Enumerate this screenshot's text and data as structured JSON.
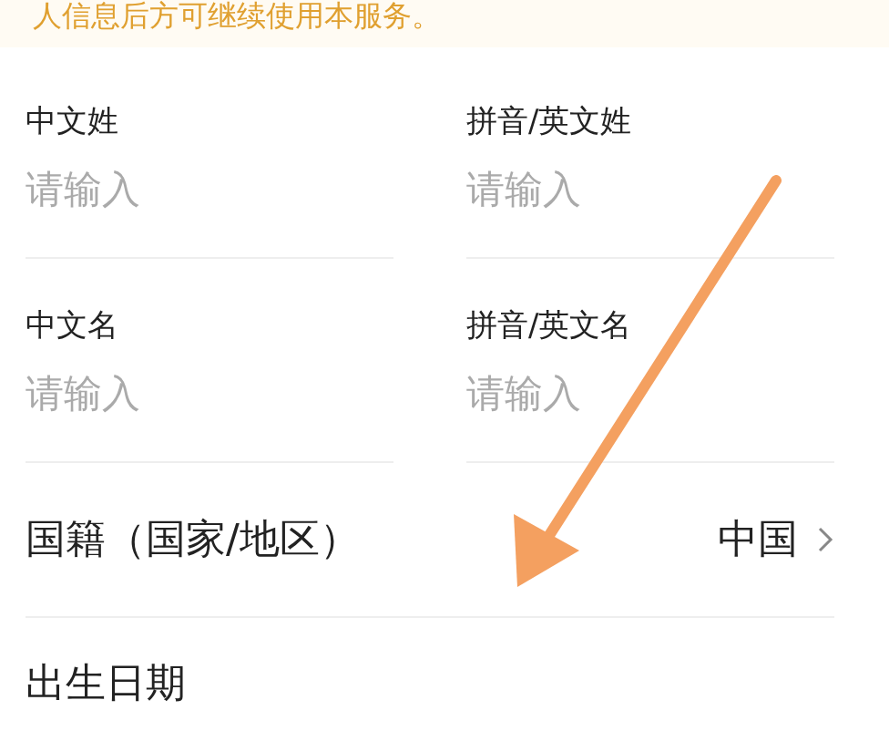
{
  "notice": "人信息后方可继续使用本服务。",
  "name_fields": [
    {
      "label": "中文姓",
      "placeholder": "请输入"
    },
    {
      "label": "拼音/英文姓",
      "placeholder": "请输入"
    },
    {
      "label": "中文名",
      "placeholder": "请输入"
    },
    {
      "label": "拼音/英文名",
      "placeholder": "请输入"
    }
  ],
  "rows": [
    {
      "label": "国籍（国家/地区）",
      "value": "中国",
      "kind": "select"
    },
    {
      "label": "出生日期",
      "kind": "date"
    }
  ]
}
